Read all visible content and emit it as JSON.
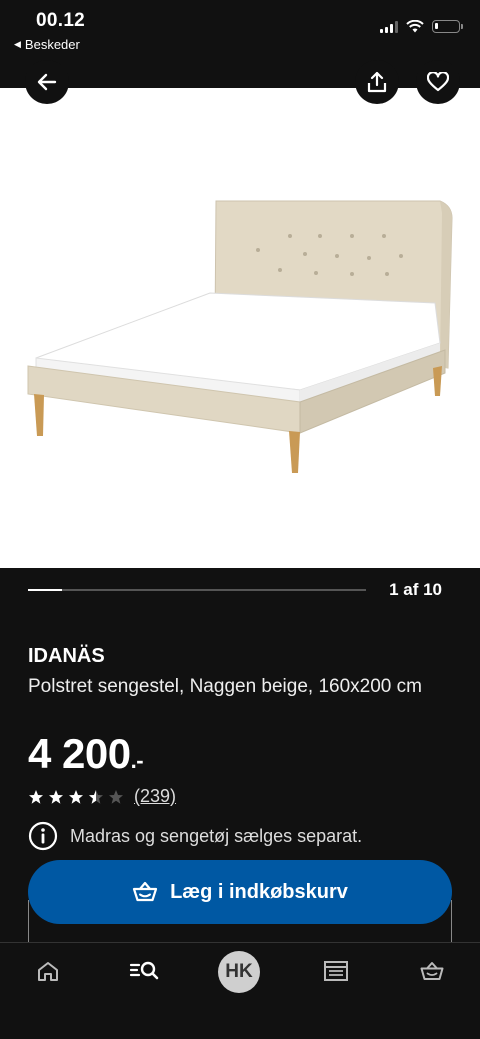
{
  "status_bar": {
    "time": "00.12",
    "back_app": "Beskeder"
  },
  "progress": {
    "current": 1,
    "total": 10,
    "label": "1 af 10"
  },
  "product": {
    "brand": "IDANÄS",
    "description": "Polstret sengestel, Naggen beige, 160x200 cm",
    "price": "4 200",
    "price_suffix": ".-",
    "rating_value": 3.5,
    "rating_max": 5,
    "review_count": "(239)",
    "info_text": "Madras og sengetøj sælges separat."
  },
  "actions": {
    "add_to_cart": "Læg i indkøbskurv"
  },
  "bottom_nav": {
    "avatar_initials": "HK",
    "items": [
      "home-icon",
      "search-icon",
      "avatar",
      "store-icon",
      "cart-icon"
    ]
  },
  "colors": {
    "background": "#111111",
    "accent": "#0058a3",
    "bed_fabric": "#e0d7c3",
    "bed_legs": "#c99a55"
  }
}
